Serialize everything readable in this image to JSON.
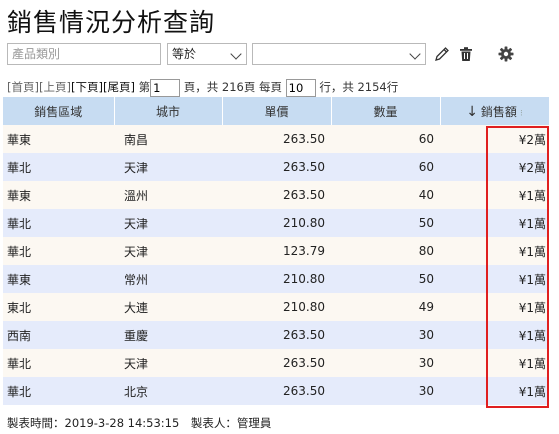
{
  "title": "銷售情況分析查詢",
  "filter": {
    "category_placeholder": "產品類別",
    "operator": "等於",
    "value": ""
  },
  "icons": {
    "edit": "pencil-icon",
    "delete": "trash-icon",
    "settings": "gear-icon"
  },
  "pager": {
    "first": "[首頁]",
    "prev": "[上頁]",
    "next": "[下頁]",
    "last": "[尾頁]",
    "page_prefix": "第",
    "page_value": "1",
    "page_suffix": "頁，共 216頁 每頁",
    "per_page_value": "10",
    "rows_suffix": "行，共 2154行"
  },
  "table": {
    "columns": [
      "銷售區域",
      "城市",
      "單價",
      "數量",
      "銷售額"
    ],
    "sort_arrow": "↓",
    "sort_dots": "⁝",
    "rows": [
      [
        "華東",
        "南昌",
        "263.50",
        "60",
        "¥2萬"
      ],
      [
        "華北",
        "天津",
        "263.50",
        "60",
        "¥2萬"
      ],
      [
        "華東",
        "溫州",
        "263.50",
        "40",
        "¥1萬"
      ],
      [
        "華北",
        "天津",
        "210.80",
        "50",
        "¥1萬"
      ],
      [
        "華北",
        "天津",
        "123.79",
        "80",
        "¥1萬"
      ],
      [
        "華東",
        "常州",
        "210.80",
        "50",
        "¥1萬"
      ],
      [
        "東北",
        "大連",
        "210.80",
        "49",
        "¥1萬"
      ],
      [
        "西南",
        "重慶",
        "263.50",
        "30",
        "¥1萬"
      ],
      [
        "華北",
        "天津",
        "263.50",
        "30",
        "¥1萬"
      ],
      [
        "華北",
        "北京",
        "263.50",
        "30",
        "¥1萬"
      ]
    ]
  },
  "footer": "製表時間：2019-3-28 14:53:15　製表人：管理員",
  "colors": {
    "header_bg": "#c7dcf2",
    "row_odd": "#fcf8f2",
    "row_even": "#e5ebfb",
    "highlight": "#e01f1f"
  }
}
